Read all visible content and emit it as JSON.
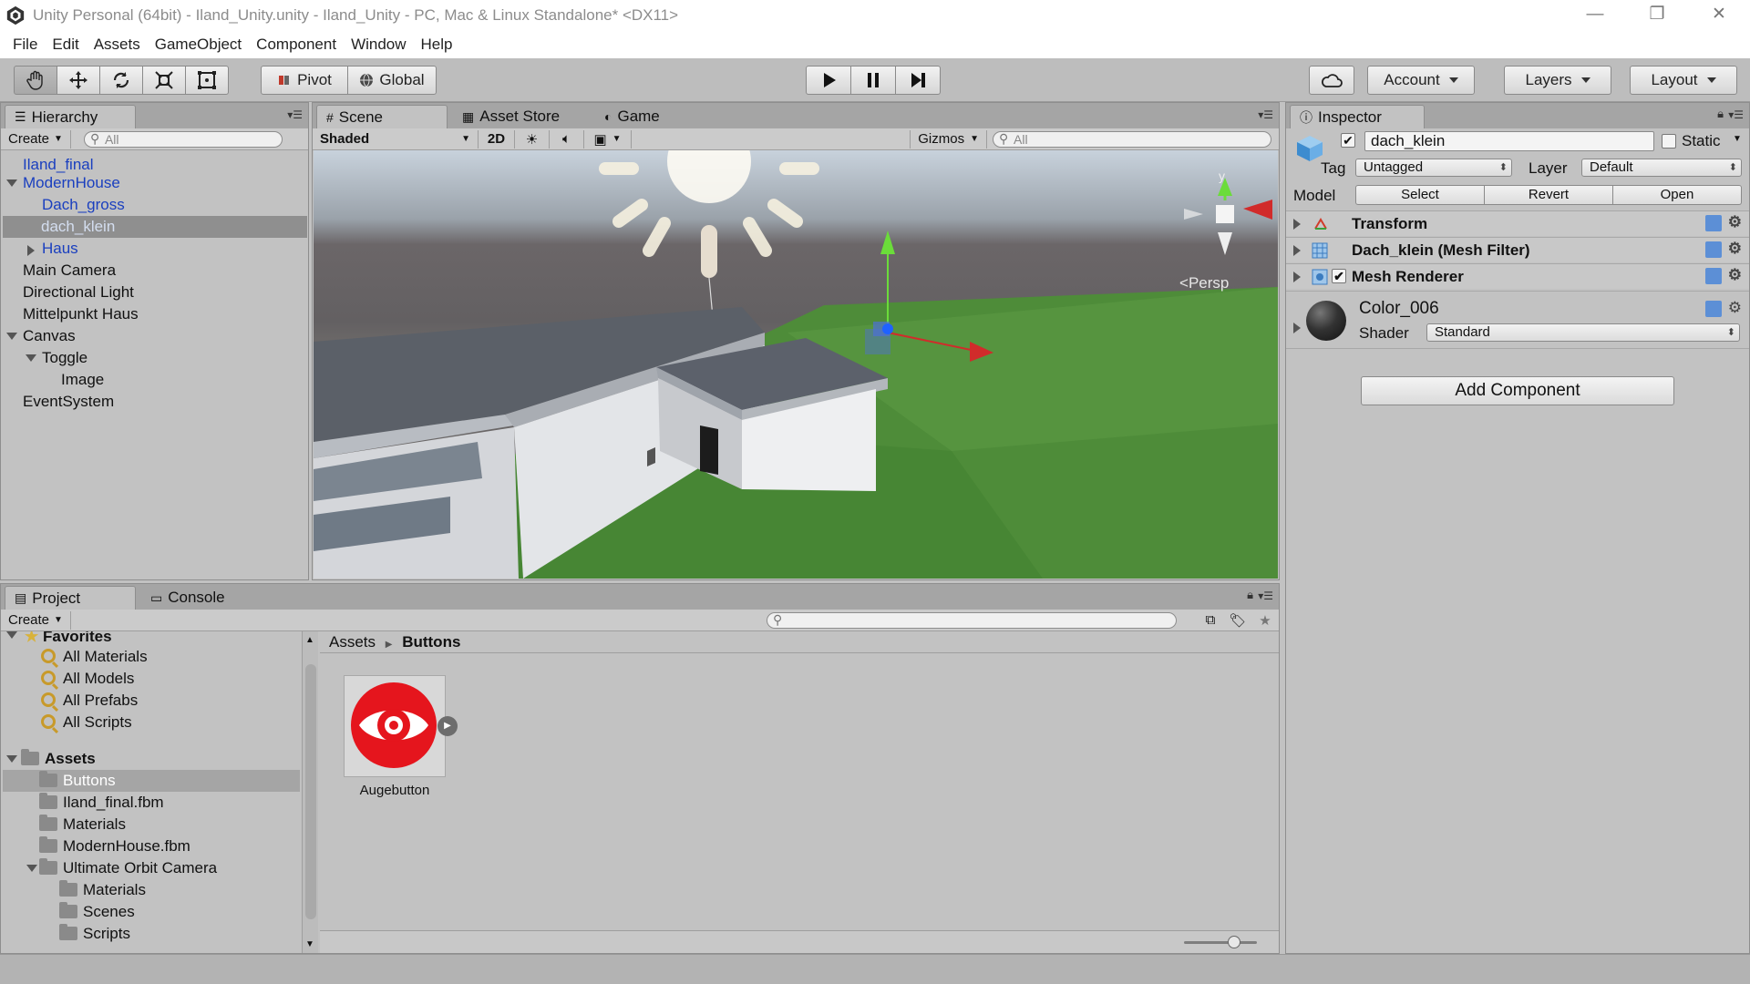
{
  "window": {
    "title": "Unity Personal (64bit) - Iland_Unity.unity - Iland_Unity - PC, Mac & Linux Standalone* <DX11>",
    "minimize": "—",
    "restore": "❐",
    "close": "✕"
  },
  "menu": [
    "File",
    "Edit",
    "Assets",
    "GameObject",
    "Component",
    "Window",
    "Help"
  ],
  "toolbar": {
    "pivot_label": "Pivot",
    "global_label": "Global",
    "account_label": "Account",
    "layers_label": "Layers",
    "layout_label": "Layout"
  },
  "hierarchy": {
    "tab_label": "Hierarchy",
    "create_label": "Create",
    "search_placeholder": "All",
    "items": [
      {
        "label": "Iland_final"
      },
      {
        "label": "ModernHouse"
      },
      {
        "label": "Dach_gross"
      },
      {
        "label": "dach_klein"
      },
      {
        "label": "Haus"
      },
      {
        "label": "Main Camera"
      },
      {
        "label": "Directional Light"
      },
      {
        "label": "Mittelpunkt Haus"
      },
      {
        "label": "Canvas"
      },
      {
        "label": "Toggle"
      },
      {
        "label": "Image"
      },
      {
        "label": "EventSystem"
      }
    ]
  },
  "scene": {
    "tabs": [
      {
        "label": "Scene"
      },
      {
        "label": "Asset Store"
      },
      {
        "label": "Game"
      }
    ],
    "shading_mode": "Shaded",
    "mode_2d": "2D",
    "gizmos_label": "Gizmos",
    "search_placeholder": "All",
    "persp_label": "Persp",
    "axis_y": "y"
  },
  "inspector": {
    "tab_label": "Inspector",
    "object_name": "dach_klein",
    "static_label": "Static",
    "tag_label": "Tag",
    "tag_value": "Untagged",
    "layer_label": "Layer",
    "layer_value": "Default",
    "model_label": "Model",
    "model_buttons": {
      "select": "Select",
      "revert": "Revert",
      "open": "Open"
    },
    "components": [
      {
        "label": "Transform"
      },
      {
        "label": "Dach_klein (Mesh Filter)"
      },
      {
        "label": "Mesh Renderer"
      }
    ],
    "material_name": "Color_006",
    "shader_label": "Shader",
    "shader_value": "Standard",
    "add_component_label": "Add Component"
  },
  "project": {
    "tabs": [
      {
        "label": "Project"
      },
      {
        "label": "Console"
      }
    ],
    "create_label": "Create",
    "favorites_label": "Favorites",
    "favorites": [
      {
        "label": "All Materials"
      },
      {
        "label": "All Models"
      },
      {
        "label": "All Prefabs"
      },
      {
        "label": "All Scripts"
      }
    ],
    "assets_label": "Assets",
    "folders": [
      {
        "label": "Buttons"
      },
      {
        "label": "Iland_final.fbm"
      },
      {
        "label": "Materials"
      },
      {
        "label": "ModernHouse.fbm"
      },
      {
        "label": "Ultimate Orbit Camera"
      },
      {
        "label": "Materials"
      },
      {
        "label": "Scenes"
      },
      {
        "label": "Scripts"
      }
    ],
    "breadcrumb": {
      "root": "Assets",
      "current": "Buttons"
    },
    "asset_name": "Augebutton"
  }
}
